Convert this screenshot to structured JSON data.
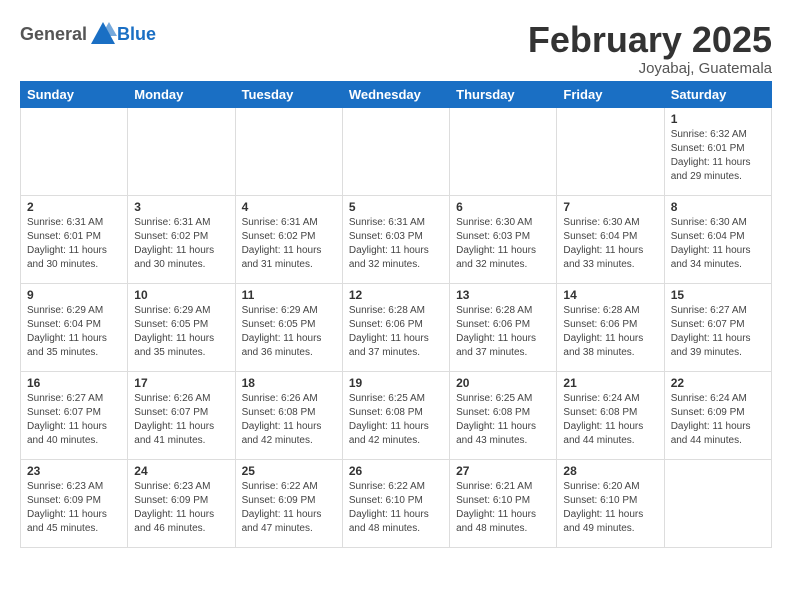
{
  "header": {
    "logo_general": "General",
    "logo_blue": "Blue",
    "month_title": "February 2025",
    "location": "Joyabaj, Guatemala"
  },
  "weekdays": [
    "Sunday",
    "Monday",
    "Tuesday",
    "Wednesday",
    "Thursday",
    "Friday",
    "Saturday"
  ],
  "weeks": [
    [
      {
        "day": "",
        "info": ""
      },
      {
        "day": "",
        "info": ""
      },
      {
        "day": "",
        "info": ""
      },
      {
        "day": "",
        "info": ""
      },
      {
        "day": "",
        "info": ""
      },
      {
        "day": "",
        "info": ""
      },
      {
        "day": "1",
        "info": "Sunrise: 6:32 AM\nSunset: 6:01 PM\nDaylight: 11 hours and 29 minutes."
      }
    ],
    [
      {
        "day": "2",
        "info": "Sunrise: 6:31 AM\nSunset: 6:01 PM\nDaylight: 11 hours and 30 minutes."
      },
      {
        "day": "3",
        "info": "Sunrise: 6:31 AM\nSunset: 6:02 PM\nDaylight: 11 hours and 30 minutes."
      },
      {
        "day": "4",
        "info": "Sunrise: 6:31 AM\nSunset: 6:02 PM\nDaylight: 11 hours and 31 minutes."
      },
      {
        "day": "5",
        "info": "Sunrise: 6:31 AM\nSunset: 6:03 PM\nDaylight: 11 hours and 32 minutes."
      },
      {
        "day": "6",
        "info": "Sunrise: 6:30 AM\nSunset: 6:03 PM\nDaylight: 11 hours and 32 minutes."
      },
      {
        "day": "7",
        "info": "Sunrise: 6:30 AM\nSunset: 6:04 PM\nDaylight: 11 hours and 33 minutes."
      },
      {
        "day": "8",
        "info": "Sunrise: 6:30 AM\nSunset: 6:04 PM\nDaylight: 11 hours and 34 minutes."
      }
    ],
    [
      {
        "day": "9",
        "info": "Sunrise: 6:29 AM\nSunset: 6:04 PM\nDaylight: 11 hours and 35 minutes."
      },
      {
        "day": "10",
        "info": "Sunrise: 6:29 AM\nSunset: 6:05 PM\nDaylight: 11 hours and 35 minutes."
      },
      {
        "day": "11",
        "info": "Sunrise: 6:29 AM\nSunset: 6:05 PM\nDaylight: 11 hours and 36 minutes."
      },
      {
        "day": "12",
        "info": "Sunrise: 6:28 AM\nSunset: 6:06 PM\nDaylight: 11 hours and 37 minutes."
      },
      {
        "day": "13",
        "info": "Sunrise: 6:28 AM\nSunset: 6:06 PM\nDaylight: 11 hours and 37 minutes."
      },
      {
        "day": "14",
        "info": "Sunrise: 6:28 AM\nSunset: 6:06 PM\nDaylight: 11 hours and 38 minutes."
      },
      {
        "day": "15",
        "info": "Sunrise: 6:27 AM\nSunset: 6:07 PM\nDaylight: 11 hours and 39 minutes."
      }
    ],
    [
      {
        "day": "16",
        "info": "Sunrise: 6:27 AM\nSunset: 6:07 PM\nDaylight: 11 hours and 40 minutes."
      },
      {
        "day": "17",
        "info": "Sunrise: 6:26 AM\nSunset: 6:07 PM\nDaylight: 11 hours and 41 minutes."
      },
      {
        "day": "18",
        "info": "Sunrise: 6:26 AM\nSunset: 6:08 PM\nDaylight: 11 hours and 42 minutes."
      },
      {
        "day": "19",
        "info": "Sunrise: 6:25 AM\nSunset: 6:08 PM\nDaylight: 11 hours and 42 minutes."
      },
      {
        "day": "20",
        "info": "Sunrise: 6:25 AM\nSunset: 6:08 PM\nDaylight: 11 hours and 43 minutes."
      },
      {
        "day": "21",
        "info": "Sunrise: 6:24 AM\nSunset: 6:08 PM\nDaylight: 11 hours and 44 minutes."
      },
      {
        "day": "22",
        "info": "Sunrise: 6:24 AM\nSunset: 6:09 PM\nDaylight: 11 hours and 44 minutes."
      }
    ],
    [
      {
        "day": "23",
        "info": "Sunrise: 6:23 AM\nSunset: 6:09 PM\nDaylight: 11 hours and 45 minutes."
      },
      {
        "day": "24",
        "info": "Sunrise: 6:23 AM\nSunset: 6:09 PM\nDaylight: 11 hours and 46 minutes."
      },
      {
        "day": "25",
        "info": "Sunrise: 6:22 AM\nSunset: 6:09 PM\nDaylight: 11 hours and 47 minutes."
      },
      {
        "day": "26",
        "info": "Sunrise: 6:22 AM\nSunset: 6:10 PM\nDaylight: 11 hours and 48 minutes."
      },
      {
        "day": "27",
        "info": "Sunrise: 6:21 AM\nSunset: 6:10 PM\nDaylight: 11 hours and 48 minutes."
      },
      {
        "day": "28",
        "info": "Sunrise: 6:20 AM\nSunset: 6:10 PM\nDaylight: 11 hours and 49 minutes."
      },
      {
        "day": "",
        "info": ""
      }
    ]
  ]
}
